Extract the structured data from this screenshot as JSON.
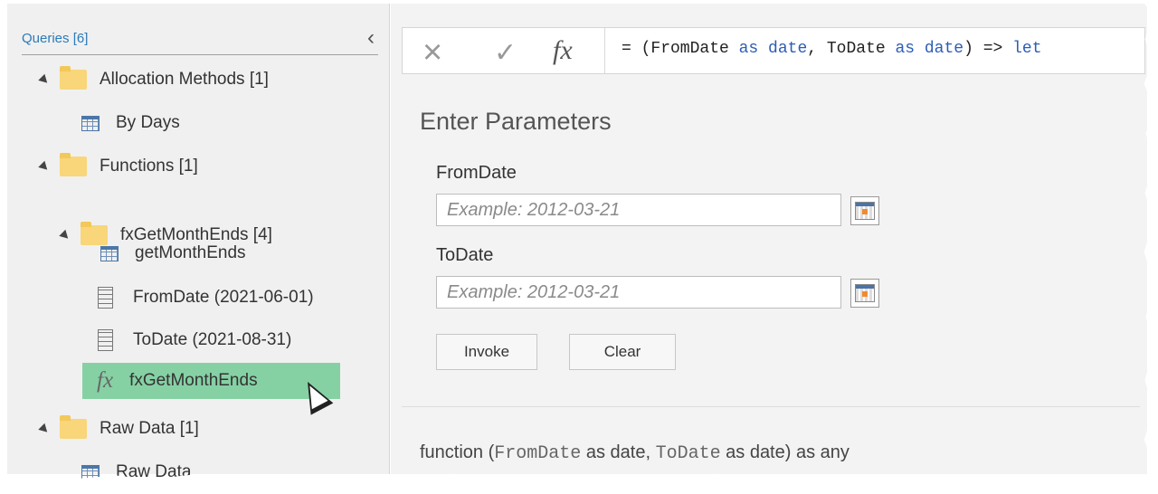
{
  "queries": {
    "title": "Queries [6]",
    "collapse_icon": "chevron-left-icon",
    "items": [
      {
        "label": "Allocation Methods [1]",
        "icon": "folder-icon"
      },
      {
        "label": "By Days",
        "icon": "table-icon"
      },
      {
        "label": "Functions [1]",
        "icon": "folder-icon"
      },
      {
        "label": "fxGetMonthEnds [4]",
        "icon": "folder-icon"
      },
      {
        "label": "getMonthEnds",
        "icon": "table-icon"
      },
      {
        "label": "FromDate (2021-06-01)",
        "icon": "parameter-icon"
      },
      {
        "label": "ToDate (2021-08-31)",
        "icon": "parameter-icon"
      },
      {
        "label": "fxGetMonthEnds",
        "icon": "function-icon",
        "selected": true
      },
      {
        "label": "Raw Data [1]",
        "icon": "folder-icon"
      },
      {
        "label": "Raw Data",
        "icon": "table-icon"
      }
    ]
  },
  "formula_bar": {
    "cancel_icon": "close-icon",
    "commit_icon": "check-icon",
    "function_icon": "fx-icon",
    "prefix": "= (FromDate ",
    "as1": "as",
    "date1": " date",
    "middle": ", ToDate ",
    "as2": "as",
    "date2": " date",
    "suffix": ") => ",
    "let": "let"
  },
  "parameters": {
    "title": "Enter Parameters",
    "from_label": "FromDate",
    "from_placeholder": "Example: 2012-03-21",
    "to_label": "ToDate",
    "to_placeholder": "Example: 2012-03-21",
    "invoke_label": "Invoke",
    "clear_label": "Clear"
  },
  "signature": {
    "prefix": "function (",
    "from": "FromDate",
    "middle": " as date, ",
    "to": "ToDate",
    "suffix": " as date) as any"
  },
  "colors": {
    "selected_row": "#86d1a4",
    "folder": "#f8d679",
    "keyword": "#2d5db5"
  }
}
